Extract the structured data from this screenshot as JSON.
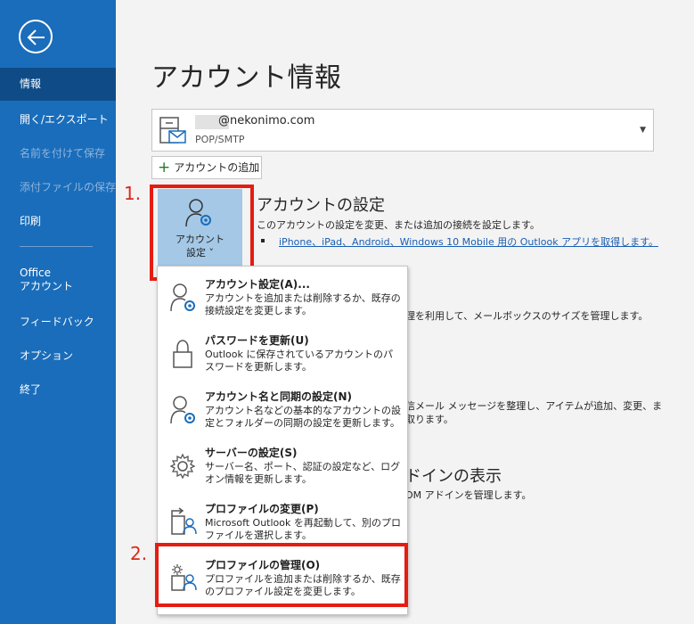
{
  "sidebar": {
    "back_label": "",
    "items": [
      {
        "label": "情報",
        "state": "active"
      },
      {
        "label": "開く/エクスポート",
        "state": "normal"
      },
      {
        "label": "名前を付けて保存",
        "state": "disabled"
      },
      {
        "label": "添付ファイルの保存",
        "state": "disabled"
      },
      {
        "label": "印刷",
        "state": "normal"
      },
      {
        "label": "Office\nアカウント",
        "state": "normal"
      },
      {
        "label": "フィードバック",
        "state": "normal"
      },
      {
        "label": "オプション",
        "state": "normal"
      },
      {
        "label": "終了",
        "state": "normal"
      }
    ]
  },
  "main": {
    "title": "アカウント情報",
    "account": {
      "email": "@nekonimo.com",
      "type": "POP/SMTP"
    },
    "add_account_label": "アカウントの追加",
    "account_settings_button": {
      "line1": "アカウント",
      "line2": "設定 ˅"
    },
    "section": {
      "title": "アカウントの設定",
      "description": "このアカウントの設定を変更、または追加の接続を設定します。",
      "link": "iPhone、iPad、Android、Windows 10 Mobile 用の Outlook アプリを取得します。"
    },
    "background_fragments": {
      "mailbox": "理を利用して、メールボックスのサイズを管理します。",
      "rules_1": "信メール メッセージを整理し、アイテムが追加、変更、ま",
      "rules_2": "取ります。",
      "addins_title": "ドインの表示",
      "addins_desc": "OM アドインを管理します。"
    }
  },
  "steps": {
    "one": "1.",
    "two": "2."
  },
  "menu": {
    "items": [
      {
        "title": "アカウント設定(A)...",
        "desc": "アカウントを追加または削除するか、既存の接続設定を変更します。",
        "icon": "account-gear-icon"
      },
      {
        "title": "パスワードを更新(U)",
        "desc": "Outlook に保存されているアカウントのパスワードを更新します。",
        "icon": "lock-icon"
      },
      {
        "title": "アカウント名と同期の設定(N)",
        "desc": "アカウント名などの基本的なアカウントの設定とフォルダーの同期の設定を更新します。",
        "icon": "account-sync-icon"
      },
      {
        "title": "サーバーの設定(S)",
        "desc": "サーバー名、ポート、認証の設定など、ログオン情報を更新します。",
        "icon": "gear-icon"
      },
      {
        "title": "プロファイルの変更(P)",
        "desc": "Microsoft Outlook を再起動して、別のプロファイルを選択します。",
        "icon": "profile-switch-icon"
      },
      {
        "title": "プロファイルの管理(O)",
        "desc": "プロファイルを追加または削除するか、既存のプロファイル設定を変更します。",
        "icon": "profile-manage-icon"
      }
    ]
  },
  "colors": {
    "sidebar": "#1a6dba",
    "sidebar_active": "#0f4b86",
    "highlight_red": "#e51c12",
    "link": "#1a5eb3"
  }
}
